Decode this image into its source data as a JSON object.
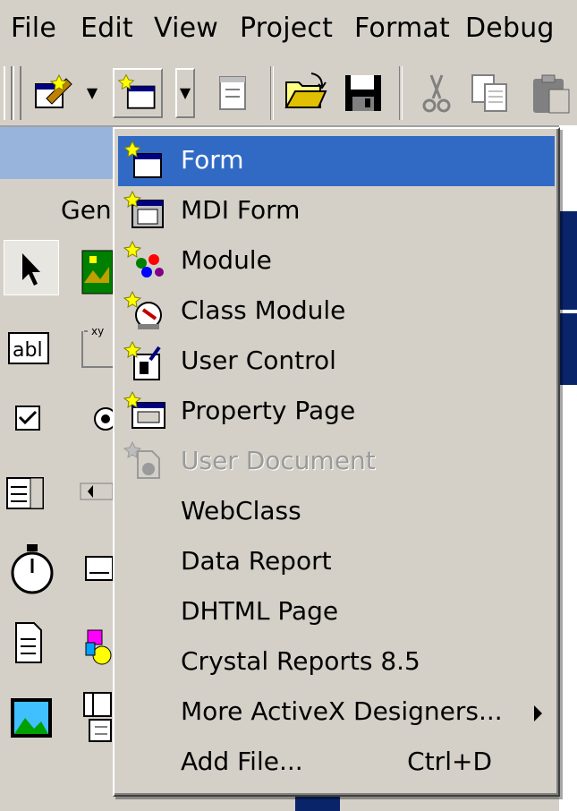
{
  "menubar": {
    "items": [
      "File",
      "Edit",
      "View",
      "Project",
      "Format",
      "Debug"
    ]
  },
  "toolbar": {
    "buttons": [
      "add-project-icon",
      "add-form-icon",
      "menu-editor-icon",
      "open-project-icon",
      "save-project-icon",
      "cut-icon",
      "copy-icon",
      "paste-icon"
    ]
  },
  "toolbox": {
    "tab_label": "Gen",
    "tools": [
      "pointer-icon",
      "picturebox-icon",
      "textbox-icon",
      "frame-icon",
      "checkbox-icon",
      "optionbutton-icon",
      "listbox-icon",
      "hscrollbar-icon",
      "timer-icon",
      "drivelistbox-icon",
      "filelistbox-icon",
      "shape-icon",
      "image-icon",
      "data-icon"
    ]
  },
  "add_menu": {
    "items": [
      {
        "label": "Form",
        "icon": "form-icon",
        "state": "selected"
      },
      {
        "label": "MDI Form",
        "icon": "mdi-form-icon",
        "state": "normal"
      },
      {
        "label": "Module",
        "icon": "module-icon",
        "state": "normal"
      },
      {
        "label": "Class Module",
        "icon": "class-module-icon",
        "state": "normal"
      },
      {
        "label": "User Control",
        "icon": "user-control-icon",
        "state": "normal"
      },
      {
        "label": "Property Page",
        "icon": "property-page-icon",
        "state": "normal"
      },
      {
        "label": "User Document",
        "icon": "user-document-icon",
        "state": "disabled"
      },
      {
        "label": "WebClass",
        "icon": "",
        "state": "normal"
      },
      {
        "label": "Data Report",
        "icon": "",
        "state": "normal"
      },
      {
        "label": "DHTML Page",
        "icon": "",
        "state": "normal"
      },
      {
        "label": "Crystal Reports 8.5",
        "icon": "",
        "state": "normal"
      },
      {
        "label": "More ActiveX Designers...",
        "icon": "",
        "state": "submenu"
      },
      {
        "label": "Add File...",
        "icon": "",
        "state": "normal",
        "shortcut": "Ctrl+D"
      }
    ]
  },
  "colors": {
    "highlight": "#316ac5",
    "face": "#d4d0c8",
    "title_blue": "#0a246a"
  }
}
